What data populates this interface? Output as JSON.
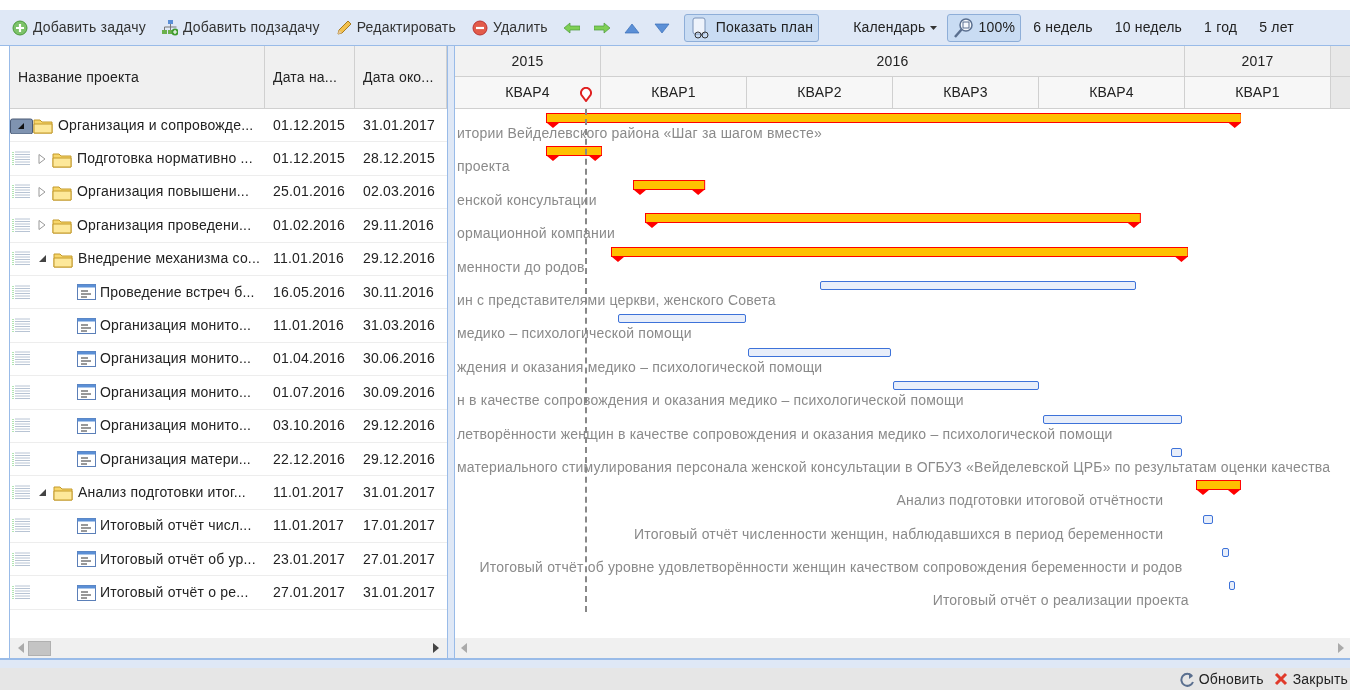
{
  "toolbar": {
    "actions": [
      {
        "label": "Добавить задачу"
      },
      {
        "label": "Добавить подзадачу"
      },
      {
        "label": "Редактировать"
      },
      {
        "label": "Удалить"
      }
    ],
    "plan_toggle": {
      "label": "Показать план",
      "selected": true
    },
    "calendar_menu": {
      "label": "Календарь"
    },
    "zoom_toggle": {
      "label": "100%",
      "selected": true
    },
    "scales": [
      {
        "label": "6 недель"
      },
      {
        "label": "10 недель"
      },
      {
        "label": "1 год"
      },
      {
        "label": "5 лет"
      }
    ]
  },
  "grid": {
    "columns": [
      "Название проекта",
      "Дата на...",
      "Дата око..."
    ],
    "rows": [
      {
        "kind": "folder",
        "name": "Организация и сопровожде...",
        "start": "01.12.2015",
        "end": "31.01.2017",
        "expanded": true,
        "bar_label": "итории Вейделевского района «Шаг за шагом вместе»",
        "label_clipped": true,
        "children": [
          {
            "kind": "folder",
            "name": "Подготовка нормативно ...",
            "start": "01.12.2015",
            "end": "28.12.2015",
            "expanded": false,
            "bar_label": "проекта",
            "label_clipped": true
          },
          {
            "kind": "folder",
            "name": "Организация повышени...",
            "start": "25.01.2016",
            "end": "02.03.2016",
            "expanded": false,
            "bar_label": "енской консультации",
            "label_clipped": true
          },
          {
            "kind": "folder",
            "name": "Организация проведени...",
            "start": "01.02.2016",
            "end": "29.11.2016",
            "expanded": false,
            "bar_label": "ормационной компании",
            "label_clipped": true
          },
          {
            "kind": "folder",
            "name": "Внедрение механизма со...",
            "start": "11.01.2016",
            "end": "29.12.2016",
            "expanded": true,
            "bar_label": "менности до родов",
            "label_clipped": true,
            "children": [
              {
                "kind": "task",
                "name": "Проведение встреч б...",
                "start": "16.05.2016",
                "end": "30.11.2016",
                "bar_label": "ин с представителями церкви, женского Совета",
                "label_clipped": true
              },
              {
                "kind": "task",
                "name": "Организация монито...",
                "start": "11.01.2016",
                "end": "31.03.2016",
                "bar_label": "медико – психологической помощи",
                "label_clipped": true
              },
              {
                "kind": "task",
                "name": "Организация монито...",
                "start": "01.04.2016",
                "end": "30.06.2016",
                "bar_label": "ждения и оказания медико – психологической помощи",
                "label_clipped": true
              },
              {
                "kind": "task",
                "name": "Организация монито...",
                "start": "01.07.2016",
                "end": "30.09.2016",
                "bar_label": "н в качестве сопровождения и оказания медико – психологической помощи",
                "label_clipped": true
              },
              {
                "kind": "task",
                "name": "Организация монито...",
                "start": "03.10.2016",
                "end": "29.12.2016",
                "bar_label": "летворённости женщин в качестве сопровождения и оказания медико – психологической помощи",
                "label_clipped": true
              },
              {
                "kind": "task",
                "name": "Организация матери...",
                "start": "22.12.2016",
                "end": "29.12.2016",
                "bar_label": "материального стимулирования персонала женской консультации в ОГБУЗ «Вейделевской ЦРБ» по результатам оценки качества",
                "label_clipped": true
              }
            ]
          },
          {
            "kind": "folder",
            "name": "Анализ подготовки итог...",
            "start": "11.01.2017",
            "end": "31.01.2017",
            "expanded": true,
            "bar_label": "Анализ подготовки итоговой отчётности",
            "label_clipped": false,
            "children": [
              {
                "kind": "task",
                "name": "Итоговый отчёт числ...",
                "start": "11.01.2017",
                "end": "17.01.2017",
                "bar_label": "Итоговый отчёт численности женщин, наблюдавшихся в период беременности",
                "label_clipped": false
              },
              {
                "kind": "task",
                "name": "Итоговый отчёт об ур...",
                "start": "23.01.2017",
                "end": "27.01.2017",
                "bar_label": "Итоговый отчёт об уровне удовлетворённости женщин качеством сопровождения беременности и родов",
                "label_clipped": false
              },
              {
                "kind": "task",
                "name": "Итоговый отчёт о ре...",
                "start": "27.01.2017",
                "end": "31.01.2017",
                "bar_label": "Итоговый отчёт о реализации проекта",
                "label_clipped": false
              }
            ]
          }
        ]
      }
    ]
  },
  "timeline": {
    "years": [
      {
        "label": "2015",
        "quarters": [
          "КВАР4"
        ]
      },
      {
        "label": "2016",
        "quarters": [
          "КВАР1",
          "КВАР2",
          "КВАР3",
          "КВАР4"
        ]
      },
      {
        "label": "2017",
        "quarters": [
          "КВАР1"
        ]
      }
    ]
  },
  "footer": {
    "buttons": [
      {
        "label": "Обновить"
      },
      {
        "label": "Закрыть"
      }
    ]
  }
}
